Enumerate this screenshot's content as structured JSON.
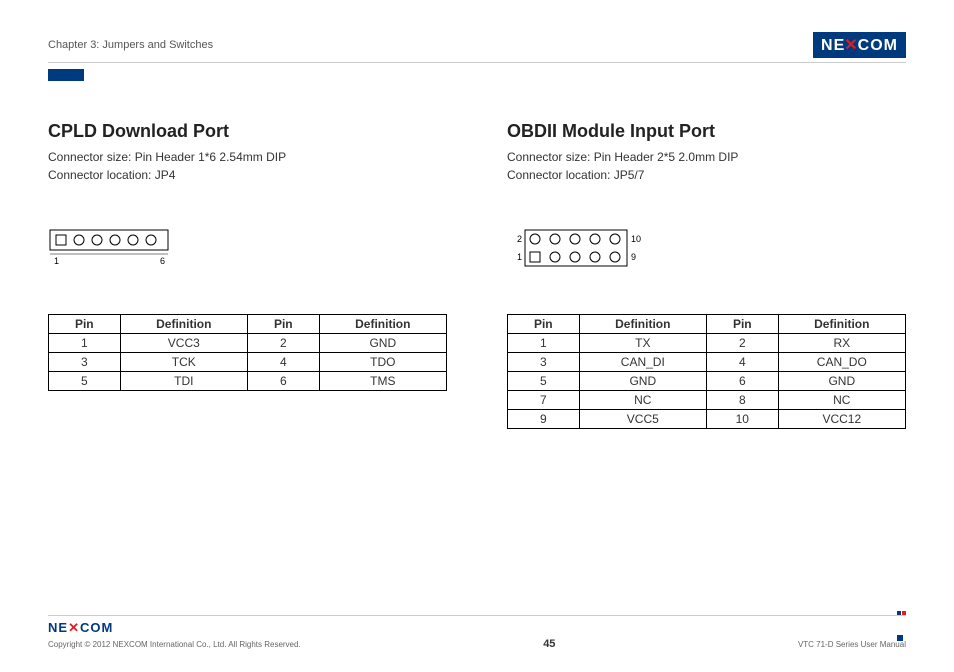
{
  "header": {
    "chapter": "Chapter 3: Jumpers and Switches",
    "brand": "NEXCOM"
  },
  "left": {
    "title": "CPLD Download Port",
    "connector_size": "Connector size: Pin Header 1*6 2.54mm DIP",
    "connector_location": "Connector location: JP4",
    "diagram_pins": [
      "1",
      "6"
    ],
    "table": {
      "headers": [
        "Pin",
        "Definition",
        "Pin",
        "Definition"
      ],
      "rows": [
        [
          "1",
          "VCC3",
          "2",
          "GND"
        ],
        [
          "3",
          "TCK",
          "4",
          "TDO"
        ],
        [
          "5",
          "TDI",
          "6",
          "TMS"
        ]
      ]
    }
  },
  "right": {
    "title": "OBDII Module Input Port",
    "connector_size": "Connector size: Pin Header 2*5 2.0mm DIP",
    "connector_location": "Connector location: JP5/7",
    "diagram_pins": [
      "2",
      "10",
      "1",
      "9"
    ],
    "table": {
      "headers": [
        "Pin",
        "Definition",
        "Pin",
        "Definition"
      ],
      "rows": [
        [
          "1",
          "TX",
          "2",
          "RX"
        ],
        [
          "3",
          "CAN_DI",
          "4",
          "CAN_DO"
        ],
        [
          "5",
          "GND",
          "6",
          "GND"
        ],
        [
          "7",
          "NC",
          "8",
          "NC"
        ],
        [
          "9",
          "VCC5",
          "10",
          "VCC12"
        ]
      ]
    }
  },
  "footer": {
    "copyright": "Copyright © 2012 NEXCOM International Co., Ltd. All Rights Reserved.",
    "page": "45",
    "manual": "VTC 71-D Series User Manual"
  }
}
